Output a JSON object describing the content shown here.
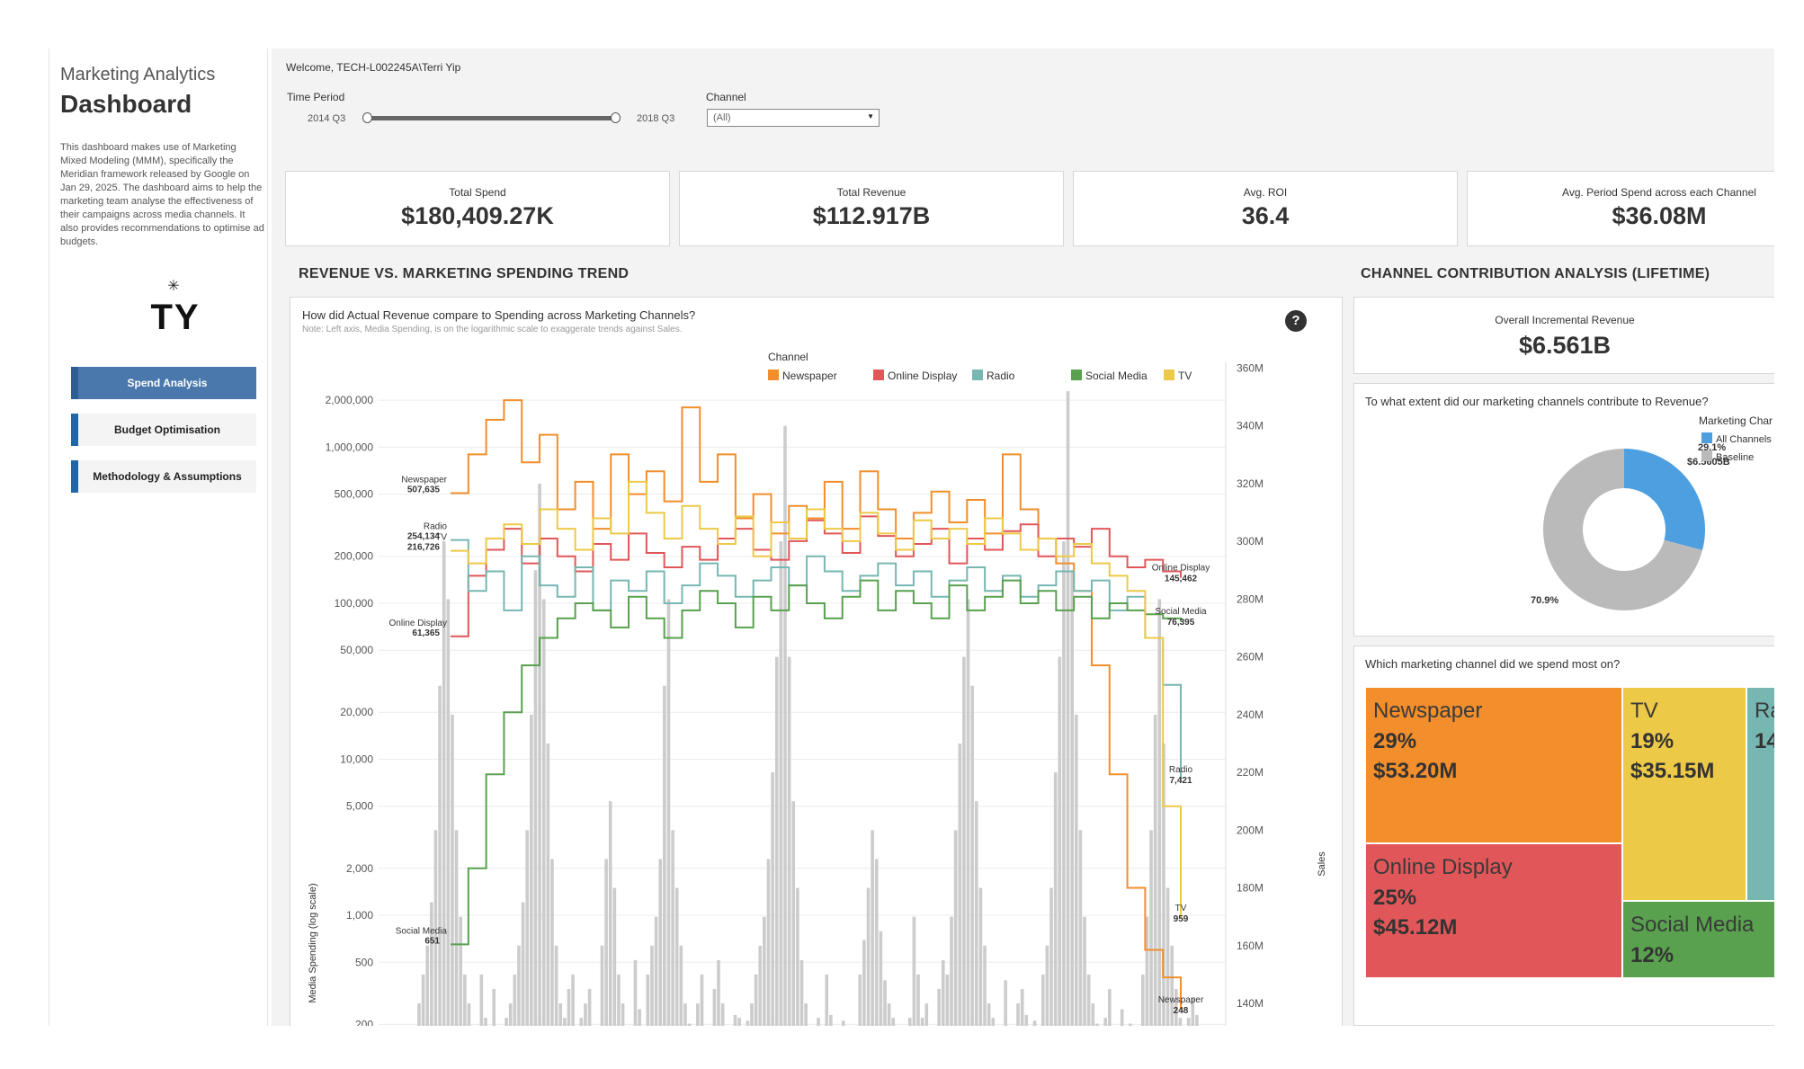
{
  "sidebar": {
    "app_name": "Marketing Analytics",
    "title": "Dashboard",
    "description": "This dashboard makes use of Marketing Mixed Modeling (MMM), specifically the Meridian framework released by Google on Jan 29, 2025. The dashboard aims to help the marketing team analyse the effectiveness of their campaigns across media channels. It also provides recommendations to optimise ad budgets.",
    "logo_text": "TY",
    "logo_icon": "spark-icon",
    "nav": [
      {
        "label": "Spend Analysis",
        "active": true
      },
      {
        "label": "Budget Optimisation",
        "active": false
      },
      {
        "label": "Methodology & Assumptions",
        "active": false
      }
    ]
  },
  "header": {
    "welcome": "Welcome, TECH-L002245A\\Terri Yip",
    "time_period": {
      "label": "Time Period",
      "min": "2014 Q3",
      "max": "2018 Q3"
    },
    "channel_filter": {
      "label": "Channel",
      "value": "(All)"
    }
  },
  "kpis": [
    {
      "label": "Total Spend",
      "value": "$180,409.27K"
    },
    {
      "label": "Total Revenue",
      "value": "$112.917B"
    },
    {
      "label": "Avg. ROI",
      "value": "36.4"
    },
    {
      "label": "Avg. Period Spend across each Channel",
      "value": "$36.08M"
    }
  ],
  "sections": {
    "trend": "REVENUE VS. MARKETING SPENDING TREND",
    "contribution": "CHANNEL CONTRIBUTION ANALYSIS (LIFETIME)"
  },
  "trend_chart": {
    "question": "How did Actual Revenue compare to Spending across Marketing Channels?",
    "note": "Note: Left axis, Media Spending, is on the logarithmic scale to exaggerate trends against Sales.",
    "help_icon": "question-icon"
  },
  "contribution": {
    "overall_label": "Overall Incremental Revenue",
    "overall_value": "$6.561B",
    "donut_question": "To what extent did our marketing channels contribute to Revenue?",
    "treemap_question": "Which marketing channel did we spend most on?"
  },
  "colors": {
    "Newspaper": "#f28e2b",
    "Online Display": "#e15759",
    "Radio": "#76b7b2",
    "Social Media": "#59a14f",
    "TV": "#edc948",
    "All Channels": "#4e9fe0",
    "Baseline": "#bababa",
    "Sales": "#cccccc",
    "nav_active": "#4a78ac"
  },
  "chart_data": [
    {
      "type": "line",
      "title": "How did Actual Revenue compare to Spending across Marketing Channels?",
      "ylabel": "Media Spending (log scale)",
      "y2label": "Sales",
      "yscale": "log",
      "ylim": [
        150,
        3500000
      ],
      "y2lim": [
        126,
        362
      ],
      "yticks": [
        "2,000,000",
        "1,000,000",
        "500,000",
        "200,000",
        "100,000",
        "50,000",
        "20,000",
        "10,000",
        "5,000",
        "2,000",
        "1,000",
        "500",
        "200"
      ],
      "y2ticks": [
        "360M",
        "340M",
        "320M",
        "300M",
        "280M",
        "260M",
        "240M",
        "220M",
        "200M",
        "180M",
        "160M",
        "140M"
      ],
      "legend_title": "Channel",
      "legend_position": "top",
      "grid": true,
      "series": [
        {
          "name": "Newspaper",
          "start": 507635,
          "end": 248,
          "values": [
            507635,
            900000,
            1500000,
            2000000,
            800000,
            1200000,
            400000,
            600000,
            300000,
            900000,
            500000,
            700000,
            450000,
            1800000,
            600000,
            900000,
            350000,
            500000,
            280000,
            420000,
            350000,
            600000,
            300000,
            700000,
            400000,
            260000,
            380000,
            520000,
            330000,
            460000,
            280000,
            900000,
            400000,
            260000,
            180000,
            120000,
            40000,
            8000,
            1500,
            600,
            400,
            248
          ]
        },
        {
          "name": "Online Display",
          "start": 61365,
          "end": 145462,
          "values": [
            61365,
            150000,
            220000,
            300000,
            180000,
            260000,
            200000,
            160000,
            240000,
            190000,
            280000,
            210000,
            170000,
            230000,
            190000,
            260000,
            300000,
            220000,
            190000,
            250000,
            340000,
            280000,
            210000,
            360000,
            270000,
            200000,
            240000,
            300000,
            180000,
            260000,
            220000,
            290000,
            320000,
            200000,
            260000,
            230000,
            300000,
            200000,
            170000,
            190000,
            160000,
            145462
          ]
        },
        {
          "name": "Radio",
          "start": 254134,
          "end": 7421,
          "values": [
            254134,
            120000,
            160000,
            90000,
            200000,
            130000,
            110000,
            170000,
            90000,
            140000,
            120000,
            160000,
            100000,
            130000,
            180000,
            150000,
            110000,
            140000,
            170000,
            130000,
            200000,
            160000,
            120000,
            150000,
            180000,
            130000,
            160000,
            110000,
            140000,
            170000,
            120000,
            150000,
            110000,
            130000,
            160000,
            120000,
            140000,
            90000,
            110000,
            60000,
            30000,
            7421
          ]
        },
        {
          "name": "Social Media",
          "start": 651,
          "end": 76395,
          "values": [
            651,
            2000,
            8000,
            20000,
            40000,
            60000,
            80000,
            100000,
            90000,
            70000,
            110000,
            80000,
            60000,
            90000,
            120000,
            100000,
            70000,
            110000,
            90000,
            130000,
            100000,
            80000,
            110000,
            140000,
            90000,
            120000,
            100000,
            80000,
            130000,
            90000,
            110000,
            140000,
            100000,
            120000,
            90000,
            110000,
            80000,
            100000,
            90000,
            85000,
            80000,
            76395
          ]
        },
        {
          "name": "TV",
          "start": 216726,
          "end": 959,
          "values": [
            216726,
            180000,
            260000,
            320000,
            240000,
            400000,
            300000,
            220000,
            350000,
            280000,
            600000,
            380000,
            260000,
            420000,
            300000,
            240000,
            360000,
            200000,
            330000,
            260000,
            400000,
            300000,
            250000,
            380000,
            280000,
            220000,
            340000,
            260000,
            300000,
            240000,
            350000,
            280000,
            220000,
            260000,
            200000,
            240000,
            180000,
            150000,
            120000,
            60000,
            5000,
            959
          ]
        }
      ],
      "end_labels": [
        {
          "name": "Online Display",
          "value": "145,462"
        },
        {
          "name": "Social Media",
          "value": "76,395"
        },
        {
          "name": "Radio",
          "value": "7,421"
        },
        {
          "name": "TV",
          "value": "959"
        },
        {
          "name": "Newspaper",
          "value": "248"
        }
      ],
      "start_labels": [
        {
          "name": "Newspaper",
          "value": "507,635"
        },
        {
          "name": "Radio",
          "value": "254,134"
        },
        {
          "name": "TV",
          "value": "216,726"
        },
        {
          "name": "Online Display",
          "value": "61,365"
        },
        {
          "name": "Social Media",
          "value": "651"
        }
      ],
      "sales_bars": [
        130,
        130,
        130,
        132,
        128,
        140,
        150,
        160,
        175,
        200,
        250,
        300,
        280,
        240,
        200,
        170,
        150,
        140,
        132,
        130,
        150,
        135,
        130,
        145,
        132,
        130,
        135,
        140,
        150,
        160,
        175,
        200,
        240,
        290,
        320,
        280,
        230,
        190,
        160,
        140,
        135,
        145,
        150,
        130,
        135,
        140,
        145,
        132,
        130,
        160,
        190,
        210,
        180,
        150,
        140,
        132,
        130,
        155,
        138,
        132,
        150,
        160,
        170,
        190,
        250,
        280,
        200,
        180,
        160,
        140,
        133,
        130,
        140,
        150,
        131,
        130,
        145,
        155,
        140,
        130,
        132,
        136,
        135,
        130,
        134,
        140,
        150,
        160,
        170,
        190,
        220,
        260,
        300,
        340,
        260,
        210,
        180,
        155,
        140,
        132,
        130,
        135,
        132,
        150,
        136,
        130,
        130,
        134,
        132,
        131,
        130,
        150,
        162,
        180,
        200,
        190,
        165,
        148,
        140,
        135,
        130,
        132,
        131,
        135,
        170,
        150,
        135,
        140,
        130,
        132,
        145,
        155,
        150,
        170,
        200,
        230,
        260,
        280,
        250,
        210,
        180,
        160,
        140,
        135,
        132,
        130,
        148,
        132,
        130,
        140,
        145,
        136,
        132,
        134,
        130,
        150,
        160,
        180,
        220,
        260,
        300,
        352,
        290,
        240,
        200,
        170,
        150,
        140,
        133,
        131,
        135,
        145,
        130,
        132,
        138,
        130,
        133,
        131,
        130,
        150,
        170,
        200,
        240,
        280,
        230,
        180,
        160,
        145,
        135,
        130,
        135,
        142,
        136,
        132,
        130
      ]
    },
    {
      "type": "pie",
      "title": "To what extent did our marketing channels contribute to Revenue?",
      "legend_title": "Marketing Char",
      "legend_position": "top-right",
      "series": [
        {
          "name": "All Channels",
          "values": [
            29.1
          ],
          "label": "29.1%"
        },
        {
          "name": "Baseline",
          "values": [
            70.9
          ],
          "label": "70.9%"
        }
      ],
      "annotation": "$6.5605B"
    },
    {
      "type": "treemap",
      "title": "Which marketing channel did we spend most on?",
      "categories": [
        "Newspaper",
        "Online Display",
        "TV",
        "Social Media",
        "Radio"
      ],
      "values": [
        29,
        25,
        19,
        12,
        14
      ],
      "labels": [
        {
          "name": "Newspaper",
          "pct": "29%",
          "amount": "$53.20M"
        },
        {
          "name": "Online Display",
          "pct": "25%",
          "amount": "$45.12M"
        },
        {
          "name": "TV",
          "pct": "19%",
          "amount": "$35.15M"
        },
        {
          "name": "Social Media",
          "pct": "12%",
          "amount": ""
        },
        {
          "name": "Ra",
          "pct": "14",
          "amount": ""
        }
      ]
    }
  ]
}
